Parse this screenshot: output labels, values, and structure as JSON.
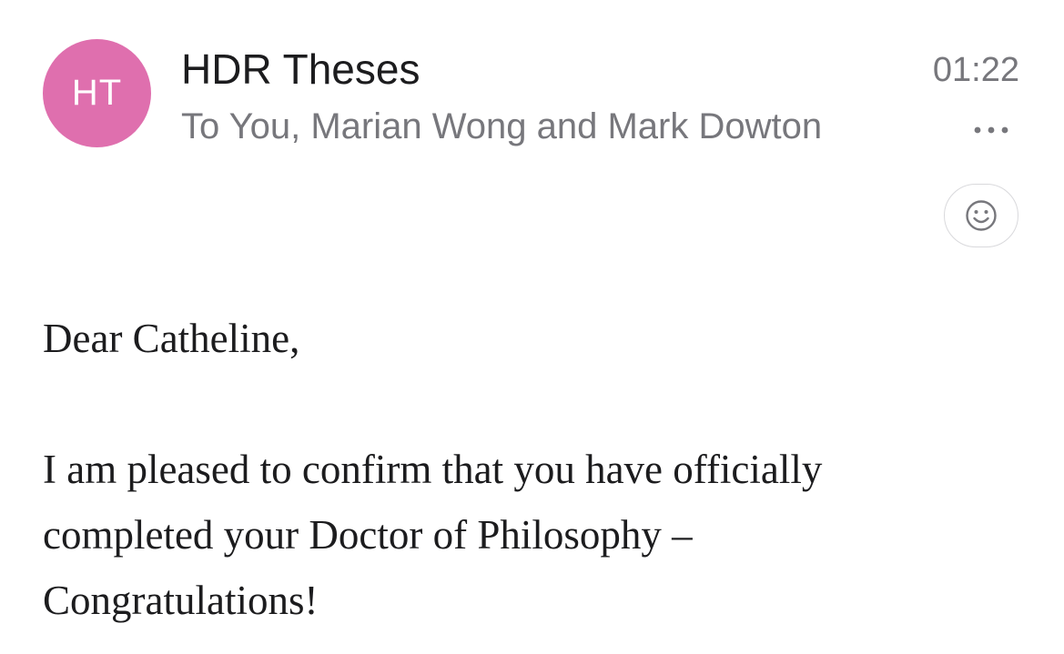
{
  "header": {
    "avatar_initials": "HT",
    "avatar_color": "#df6fae",
    "sender_name": "HDR Theses",
    "recipients": "To You, Marian Wong and Mark Dowton",
    "timestamp": "01:22",
    "more_icon": "more-horizontal-icon",
    "emoji_icon": "smiley-face-icon"
  },
  "body": {
    "greeting": "Dear Catheline,",
    "paragraph": "I am pleased to confirm that you have officially completed your Doctor of Philosophy – Congratulations!"
  }
}
